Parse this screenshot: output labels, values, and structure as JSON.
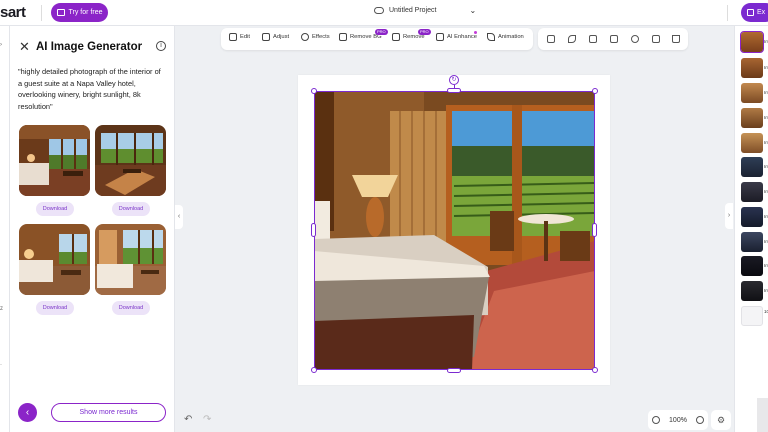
{
  "topbar": {
    "logo": "sart",
    "try_label": "Try for free",
    "project_title": "Untitled Project",
    "export_label": "Ex"
  },
  "panel": {
    "title": "AI Image Generator",
    "prompt": "\"highly detailed photograph of the interior of a guest suite at a Napa Valley hotel, overlooking winery, bright sunlight, 8k resolution\"",
    "download_label": "Download",
    "more_results_label": "Show more results"
  },
  "toolbar": {
    "edit": "Edit",
    "adjust": "Adjust",
    "effects": "Effects",
    "remove_bg": "Remove BG",
    "remove": "Remove",
    "ai_enhance": "AI Enhance",
    "animation": "Animation",
    "pro_badge": "PRO"
  },
  "bottom": {
    "zoom": "100%"
  },
  "layers": {
    "labels": [
      "Im",
      "Im",
      "Im",
      "Im",
      "Im",
      "Im",
      "Im",
      "Im",
      "Im",
      "Im",
      "Im",
      "10"
    ]
  },
  "colors": {
    "accent": "#8b24c8",
    "accent_light": "#ece3f8"
  }
}
